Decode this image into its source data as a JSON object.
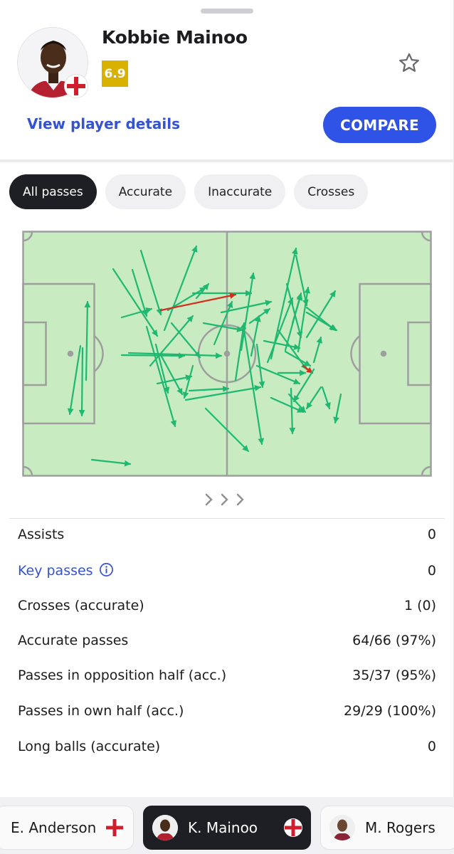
{
  "player": {
    "name": "Kobbie Mainoo",
    "rating": "6.9",
    "flag_icon": "england-flag-icon",
    "favorite_icon": "star-outline-icon"
  },
  "actions": {
    "details_link": "View player details",
    "compare_button": "COMPARE"
  },
  "filters": {
    "items": [
      "All passes",
      "Accurate",
      "Inaccurate",
      "Crosses"
    ],
    "selected": "All passes"
  },
  "pass_map": {
    "colors": {
      "pitch": "#c8ebc2",
      "lines": "#9e9e9e",
      "accurate": "#1fb870",
      "inaccurate": "#d32f1c"
    },
    "more_indicator_icon": "chevrons-right-icon"
  },
  "stats": [
    {
      "label": "Assists",
      "value": "0"
    },
    {
      "label": "Key passes",
      "value": "0",
      "info_icon": "info-icon"
    },
    {
      "label": "Crosses (accurate)",
      "value": "1 (0)"
    },
    {
      "label": "Accurate passes",
      "value": "64/66 (97%)"
    },
    {
      "label": "Passes in opposition half (acc.)",
      "value": "35/37 (95%)"
    },
    {
      "label": "Passes in own half (acc.)",
      "value": "29/29 (100%)"
    },
    {
      "label": "Long balls (accurate)",
      "value": "0"
    }
  ],
  "player_switcher": [
    {
      "name": "E. Anderson",
      "flag_icon": "england-flag-icon"
    },
    {
      "name": "K. Mainoo",
      "flag_icon": "england-flag-icon",
      "active": true
    },
    {
      "name": "M. Rogers",
      "flag_icon": "england-flag-icon"
    }
  ]
}
